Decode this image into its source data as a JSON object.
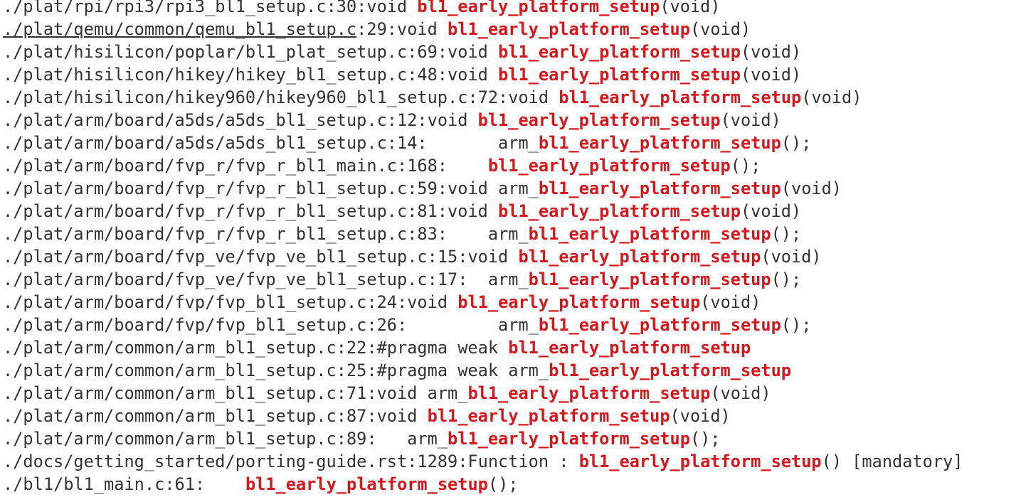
{
  "results": [
    {
      "path": "./plat/rpi/rpi3/rpi3_bl1_setup.c",
      "loc": ":30:",
      "prefix": "void ",
      "match": "bl1_early_platform_setup",
      "suffix": "(void)"
    },
    {
      "path": "./plat/qemu/common/qemu_bl1_setup.c",
      "loc": ":29:",
      "prefix": "void ",
      "match": "bl1_early_platform_setup",
      "suffix": "(void)",
      "underlined": true
    },
    {
      "path": "./plat/hisilicon/poplar/bl1_plat_setup.c",
      "loc": ":69:",
      "prefix": "void ",
      "match": "bl1_early_platform_setup",
      "suffix": "(void)"
    },
    {
      "path": "./plat/hisilicon/hikey/hikey_bl1_setup.c",
      "loc": ":48:",
      "prefix": "void ",
      "match": "bl1_early_platform_setup",
      "suffix": "(void)"
    },
    {
      "path": "./plat/hisilicon/hikey960/hikey960_bl1_setup.c",
      "loc": ":72:",
      "prefix": "void ",
      "match": "bl1_early_platform_setup",
      "suffix": "(void)"
    },
    {
      "path": "./plat/arm/board/a5ds/a5ds_bl1_setup.c",
      "loc": ":12:",
      "prefix": "void ",
      "match": "bl1_early_platform_setup",
      "suffix": "(void)"
    },
    {
      "path": "./plat/arm/board/a5ds/a5ds_bl1_setup.c",
      "loc": ":14:",
      "prefix": "       arm_",
      "match": "bl1_early_platform_setup",
      "suffix": "();"
    },
    {
      "path": "./plat/arm/board/fvp_r/fvp_r_bl1_main.c",
      "loc": ":168:",
      "prefix": "    ",
      "match": "bl1_early_platform_setup",
      "suffix": "();"
    },
    {
      "path": "./plat/arm/board/fvp_r/fvp_r_bl1_setup.c",
      "loc": ":59:",
      "prefix": "void arm_",
      "match": "bl1_early_platform_setup",
      "suffix": "(void)"
    },
    {
      "path": "./plat/arm/board/fvp_r/fvp_r_bl1_setup.c",
      "loc": ":81:",
      "prefix": "void ",
      "match": "bl1_early_platform_setup",
      "suffix": "(void)"
    },
    {
      "path": "./plat/arm/board/fvp_r/fvp_r_bl1_setup.c",
      "loc": ":83:",
      "prefix": "    arm_",
      "match": "bl1_early_platform_setup",
      "suffix": "();"
    },
    {
      "path": "./plat/arm/board/fvp_ve/fvp_ve_bl1_setup.c",
      "loc": ":15:",
      "prefix": "void ",
      "match": "bl1_early_platform_setup",
      "suffix": "(void)"
    },
    {
      "path": "./plat/arm/board/fvp_ve/fvp_ve_bl1_setup.c",
      "loc": ":17:",
      "prefix": "  arm_",
      "match": "bl1_early_platform_setup",
      "suffix": "();"
    },
    {
      "path": "./plat/arm/board/fvp/fvp_bl1_setup.c",
      "loc": ":24:",
      "prefix": "void ",
      "match": "bl1_early_platform_setup",
      "suffix": "(void)"
    },
    {
      "path": "./plat/arm/board/fvp/fvp_bl1_setup.c",
      "loc": ":26:",
      "prefix": "         arm_",
      "match": "bl1_early_platform_setup",
      "suffix": "();"
    },
    {
      "path": "./plat/arm/common/arm_bl1_setup.c",
      "loc": ":22:",
      "prefix": "#pragma weak ",
      "match": "bl1_early_platform_setup",
      "suffix": ""
    },
    {
      "path": "./plat/arm/common/arm_bl1_setup.c",
      "loc": ":25:",
      "prefix": "#pragma weak arm_",
      "match": "bl1_early_platform_setup",
      "suffix": ""
    },
    {
      "path": "./plat/arm/common/arm_bl1_setup.c",
      "loc": ":71:",
      "prefix": "void arm_",
      "match": "bl1_early_platform_setup",
      "suffix": "(void)"
    },
    {
      "path": "./plat/arm/common/arm_bl1_setup.c",
      "loc": ":87:",
      "prefix": "void ",
      "match": "bl1_early_platform_setup",
      "suffix": "(void)"
    },
    {
      "path": "./plat/arm/common/arm_bl1_setup.c",
      "loc": ":89:",
      "prefix": "   arm_",
      "match": "bl1_early_platform_setup",
      "suffix": "();"
    },
    {
      "path": "./docs/getting_started/porting-guide.rst",
      "loc": ":1289:",
      "prefix": "Function : ",
      "match": "bl1_early_platform_setup",
      "suffix": "() [mandatory]"
    },
    {
      "path": "./bl1/bl1_main.c",
      "loc": ":61:",
      "prefix": "    ",
      "match": "bl1_early_platform_setup",
      "suffix": "();"
    }
  ],
  "colors": {
    "text": "#333333",
    "match": "#d9161c",
    "background": "#ffffff"
  }
}
